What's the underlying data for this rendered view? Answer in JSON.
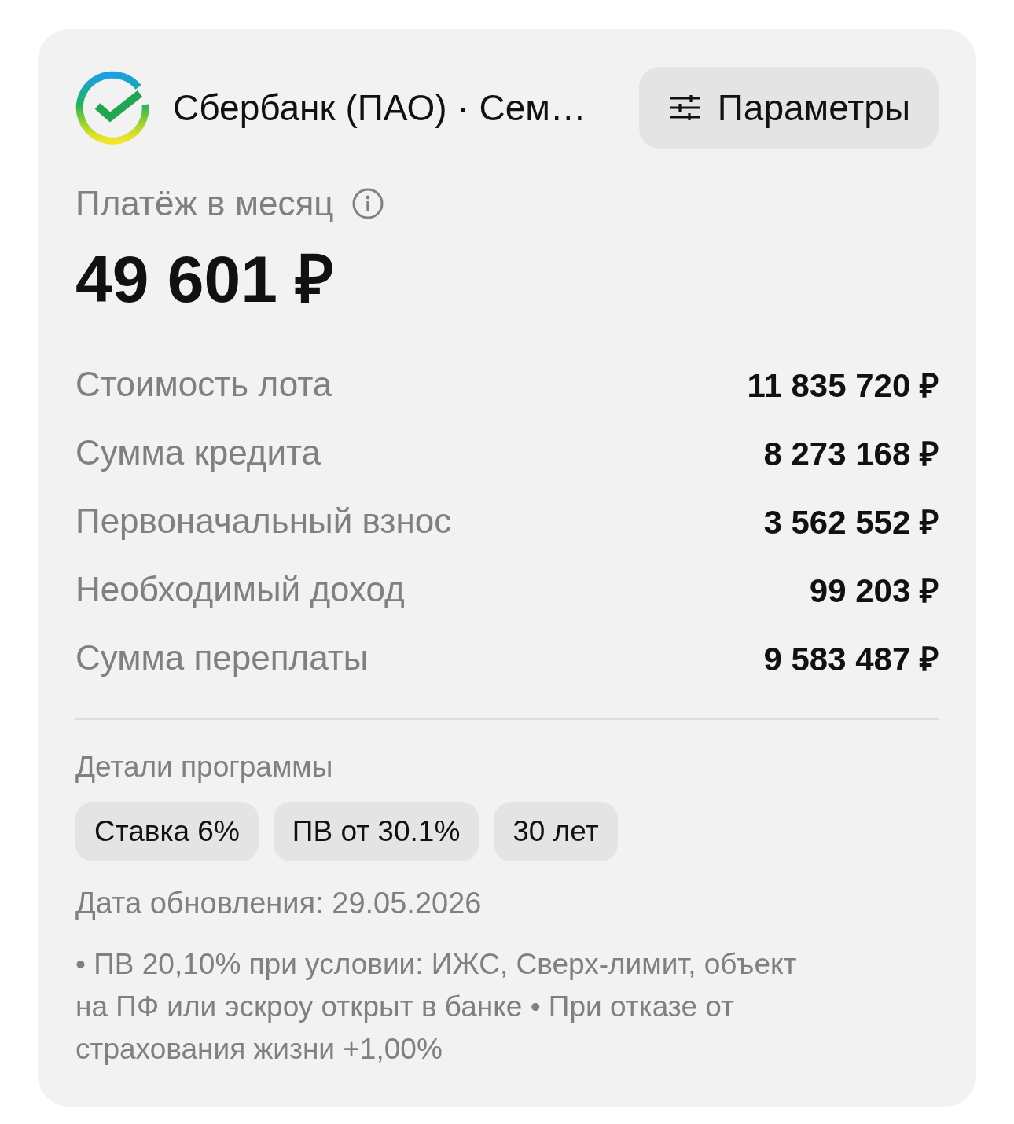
{
  "header": {
    "bank_name": "Сбербанк (ПАО) · Сем…",
    "params_button": "Параметры"
  },
  "payment": {
    "label": "Платёж в месяц",
    "amount": "49 601 ₽"
  },
  "rows": [
    {
      "label": "Стоимость лота",
      "value": "11 835 720 ₽"
    },
    {
      "label": "Сумма кредита",
      "value": "8 273 168 ₽"
    },
    {
      "label": "Первоначальный взнос",
      "value": "3 562 552 ₽"
    },
    {
      "label": "Необходимый доход",
      "value": "99 203 ₽"
    },
    {
      "label": "Сумма переплаты",
      "value": "9 583 487 ₽"
    }
  ],
  "program": {
    "title": "Детали программы",
    "tags": [
      "Ставка 6%",
      "ПВ от 30.1%",
      "30 лет"
    ]
  },
  "updated": "Дата обновления: 29.05.2026",
  "note": "• ПВ 20,10% при условии: ИЖС, Сверх-лимит, объект на ПФ или эскроу открыт в банке • При отказе от страхования жизни +1,00%"
}
